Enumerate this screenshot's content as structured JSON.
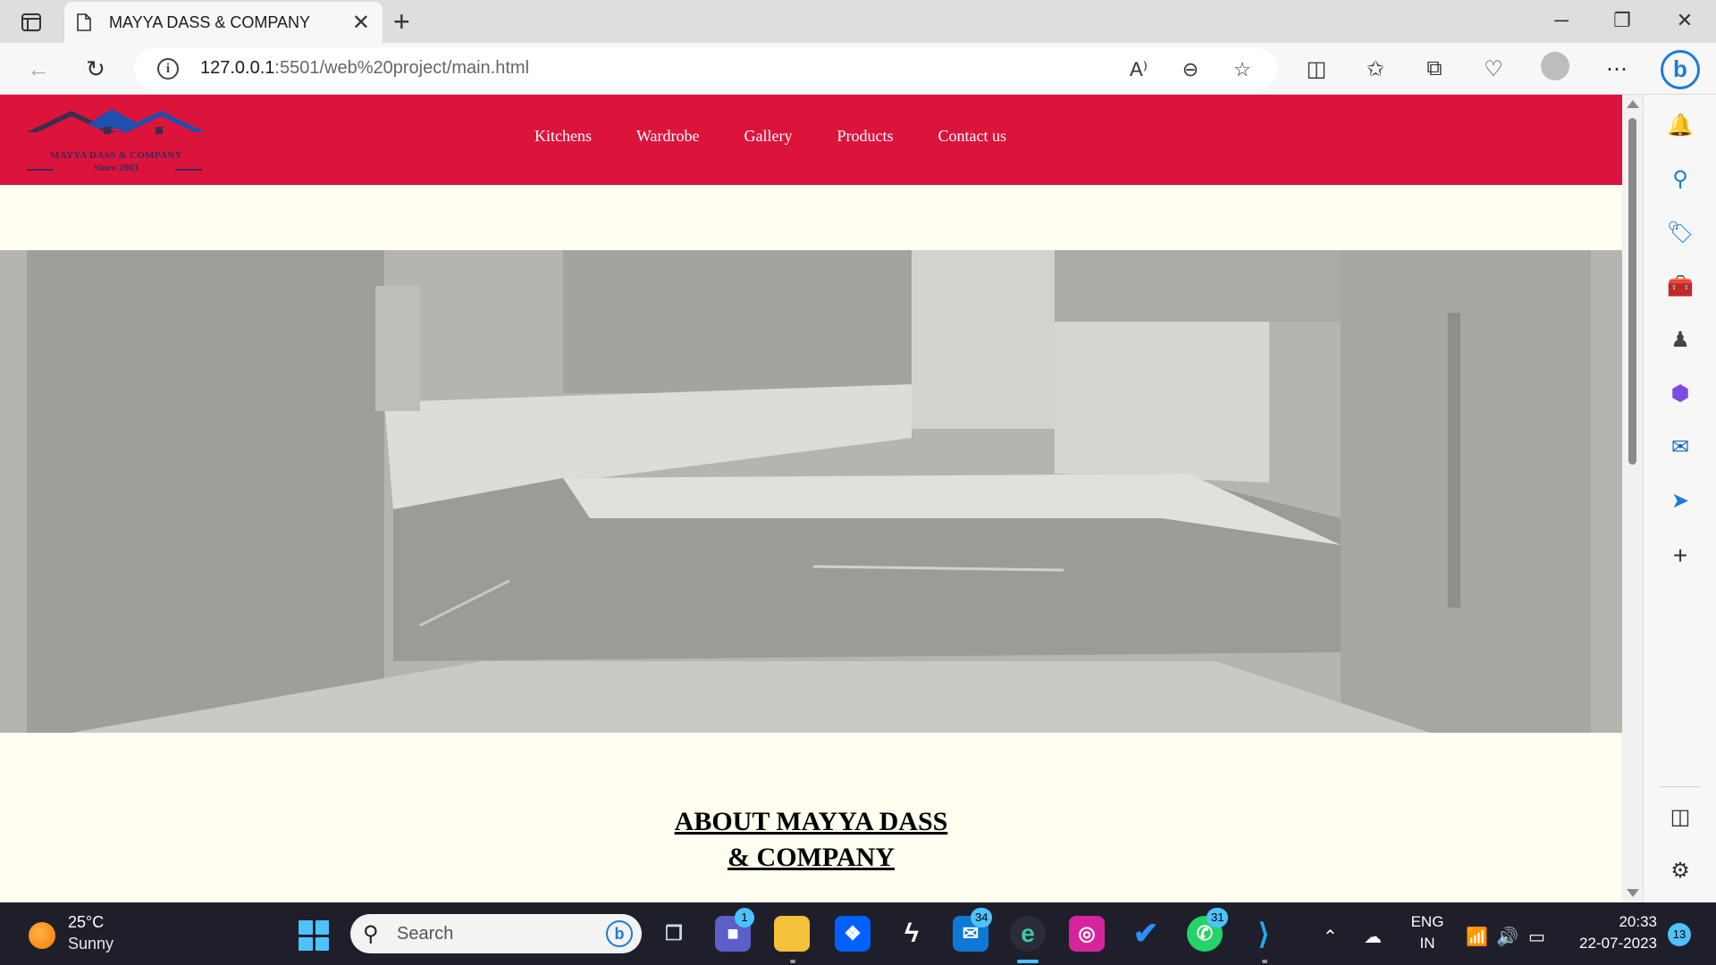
{
  "browser": {
    "tab_title": "MAYYA DASS & COMPANY",
    "url_host": "127.0.0.1",
    "url_rest": ":5501/web%20project/main.html",
    "icons": [
      "tab-actions-icon",
      "document-icon",
      "close-icon",
      "plus-icon",
      "minimize-icon",
      "restore-icon",
      "back-icon",
      "refresh-icon",
      "site-info-icon",
      "read-aloud-icon",
      "zoom-out-icon",
      "favorite-star-icon",
      "split-screen-icon",
      "favorites-icon",
      "collections-icon",
      "browser-essentials-icon",
      "profile-icon",
      "more-icon",
      "bing-copilot-icon"
    ]
  },
  "site": {
    "logo_name": "MAYYA DASS & COMPANY",
    "logo_since": "Since 2003",
    "nav": [
      {
        "label": "Kitchens"
      },
      {
        "label": "Wardrobe"
      },
      {
        "label": "Gallery"
      },
      {
        "label": "Products"
      },
      {
        "label": "Contact us"
      }
    ],
    "about_title_line1": "ABOUT MAYYA DASS",
    "about_title_line2": "& COMPANY",
    "colors": {
      "header": "#dc143c",
      "page_bg": "#fffef0",
      "hero_bg": "#b6b6b2"
    }
  },
  "sidebar": {
    "icons": [
      "bell-icon",
      "search-icon",
      "shopping-tag-icon",
      "toolbox-icon",
      "games-chess-icon",
      "microsoft-365-icon",
      "outlook-icon",
      "send-drop-icon",
      "add-icon",
      "sidebar-panel-icon",
      "settings-gear-icon"
    ]
  },
  "taskbar": {
    "temperature": "25°C",
    "condition": "Sunny",
    "search_label": "Search",
    "badges": {
      "teams": "1",
      "mail": "34",
      "whatsapp": "31"
    },
    "lang_line1": "ENG",
    "lang_line2": "IN",
    "time": "20:33",
    "date": "22-07-2023",
    "notifications": "13"
  }
}
